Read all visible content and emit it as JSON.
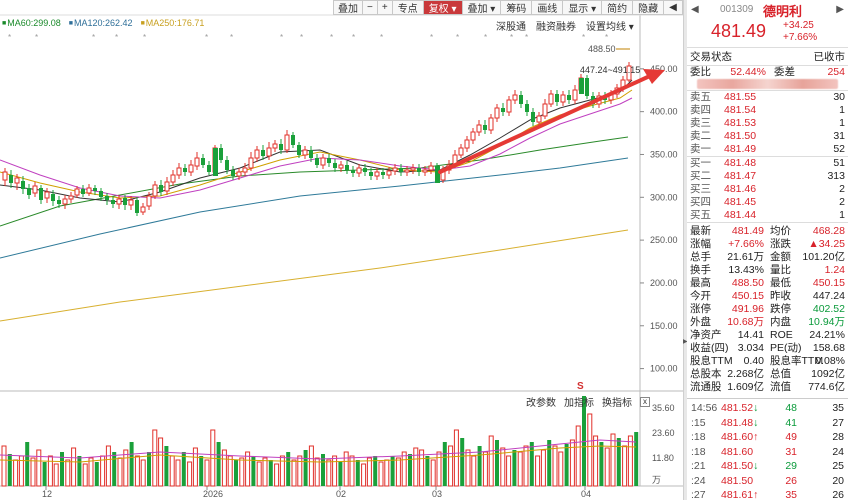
{
  "ma_legend": [
    {
      "label": "MA60:299.08",
      "color": "#1a8a2a"
    },
    {
      "label": "MA120:262.42",
      "color": "#2f6f99"
    },
    {
      "label": "MA250:176.71",
      "color": "#c8a020"
    }
  ],
  "toolbar": {
    "buttons": [
      {
        "label": "叠加",
        "icon": "overlay-icon"
      },
      {
        "label": "−",
        "icon": "minus-icon"
      },
      {
        "label": "+",
        "icon": "plus-icon"
      },
      {
        "label": "专点"
      },
      {
        "label": "复权 ▾",
        "active": true
      },
      {
        "label": "叠加 ▾"
      },
      {
        "label": "筹码"
      },
      {
        "label": "画线"
      },
      {
        "label": "显示 ▾"
      },
      {
        "label": "简约"
      },
      {
        "label": "隐藏"
      },
      {
        "label": "◀"
      }
    ]
  },
  "sub_toolbar": [
    "深股通",
    "融资融券",
    "设置均线 ▾"
  ],
  "indicator_toolbar": [
    "改参数",
    "加指标",
    "换指标"
  ],
  "indicator_close": "x",
  "chart": {
    "price_ticks": [
      {
        "label": "450.00",
        "value": 450
      },
      {
        "label": "400.00",
        "value": 400
      },
      {
        "label": "350.00",
        "value": 350
      },
      {
        "label": "300.00",
        "value": 300
      },
      {
        "label": "250.00",
        "value": 250
      },
      {
        "label": "200.00",
        "value": 200
      },
      {
        "label": "150.00",
        "value": 150
      },
      {
        "label": "100.00",
        "value": 100
      }
    ],
    "volume_ticks": [
      "35.60",
      "23.60",
      "11.80",
      "万"
    ],
    "date_ticks": [
      "12",
      "2026",
      "02",
      "03",
      "04"
    ],
    "annotations": {
      "high": "488.50",
      "range": "447.24~491.15",
      "marker": "S"
    }
  },
  "chart_data": {
    "type": "candlestick",
    "ylim": [
      75,
      500
    ],
    "volume_ylim": [
      0,
      38
    ],
    "ma": [
      "MA60",
      "MA120",
      "MA250"
    ]
  },
  "quote": {
    "nav_left": "◀",
    "nav_right": "▶",
    "code": "001309",
    "name": "德明利",
    "price": "481.49",
    "change": "+34.25",
    "change_pct": "+7.66%",
    "status_label": "交易状态",
    "status_value": "已收市",
    "weibi_label": "委比",
    "weibi_value": "52.44%",
    "weicha_label": "委差",
    "weicha_value": "254",
    "asks": [
      {
        "label": "卖五",
        "price": "481.55",
        "vol": "30"
      },
      {
        "label": "卖四",
        "price": "481.54",
        "vol": "1"
      },
      {
        "label": "卖三",
        "price": "481.53",
        "vol": "1"
      },
      {
        "label": "卖二",
        "price": "481.50",
        "vol": "31"
      },
      {
        "label": "卖一",
        "price": "481.49",
        "vol": "52"
      }
    ],
    "bids": [
      {
        "label": "买一",
        "price": "481.48",
        "vol": "51"
      },
      {
        "label": "买二",
        "price": "481.47",
        "vol": "313"
      },
      {
        "label": "买三",
        "price": "481.46",
        "vol": "2"
      },
      {
        "label": "买四",
        "price": "481.45",
        "vol": "2"
      },
      {
        "label": "买五",
        "price": "481.44",
        "vol": "1"
      }
    ],
    "stats": [
      {
        "l1": "最新",
        "v1": "481.49",
        "c1": "red",
        "l2": "均价",
        "v2": "468.28",
        "c2": "red"
      },
      {
        "l1": "涨幅",
        "v1": "+7.66%",
        "c1": "red",
        "l2": "涨跌",
        "v2": "▲34.25",
        "c2": "red"
      },
      {
        "l1": "总手",
        "v1": "21.61万",
        "c1": "",
        "l2": "金额",
        "v2": "101.20亿",
        "c2": ""
      },
      {
        "l1": "换手",
        "v1": "13.43%",
        "c1": "",
        "l2": "量比",
        "v2": "1.24",
        "c2": "red"
      },
      {
        "l1": "最高",
        "v1": "488.50",
        "c1": "red",
        "l2": "最低",
        "v2": "450.15",
        "c2": "red"
      },
      {
        "l1": "今开",
        "v1": "450.15",
        "c1": "red",
        "l2": "昨收",
        "v2": "447.24",
        "c2": ""
      },
      {
        "l1": "涨停",
        "v1": "491.96",
        "c1": "red",
        "l2": "跌停",
        "v2": "402.52",
        "c2": "green"
      },
      {
        "l1": "外盘",
        "v1": "10.68万",
        "c1": "red",
        "l2": "内盘",
        "v2": "10.94万",
        "c2": "green"
      },
      {
        "l1": "净资产",
        "v1": "14.41",
        "c1": "",
        "l2": "ROE",
        "v2": "24.21%",
        "c2": ""
      },
      {
        "l1": "收益(四)",
        "v1": "3.034",
        "c1": "",
        "l2": "PE(动)",
        "v2": "158.68",
        "c2": ""
      },
      {
        "l1": "股息TTM",
        "v1": "0.40",
        "c1": "",
        "l2": "股息率TTM",
        "v2": "0.08%",
        "c2": ""
      },
      {
        "l1": "总股本",
        "v1": "2.268亿",
        "c1": "",
        "l2": "总值",
        "v2": "1092亿",
        "c2": ""
      },
      {
        "l1": "流通股",
        "v1": "1.609亿",
        "c1": "",
        "l2": "流值",
        "v2": "774.6亿",
        "c2": ""
      }
    ],
    "ticks": [
      {
        "time": "14:56",
        "price": "481.52",
        "dir": "↓",
        "vol": "48",
        "cnt": "35"
      },
      {
        "time": ":15",
        "price": "481.48",
        "dir": "↓",
        "vol": "41",
        "cnt": "27"
      },
      {
        "time": ":18",
        "price": "481.60",
        "dir": "↑",
        "vol": "49",
        "cnt": "28"
      },
      {
        "time": ":18",
        "price": "481.60",
        "dir": "",
        "vol": "31",
        "cnt": "24"
      },
      {
        "time": ":21",
        "price": "481.50",
        "dir": "↓",
        "vol": "29",
        "cnt": "25"
      },
      {
        "time": ":24",
        "price": "481.50",
        "dir": "",
        "vol": "26",
        "cnt": "20"
      },
      {
        "time": ":27",
        "price": "481.61",
        "dir": "↑",
        "vol": "35",
        "cnt": "26"
      }
    ]
  }
}
